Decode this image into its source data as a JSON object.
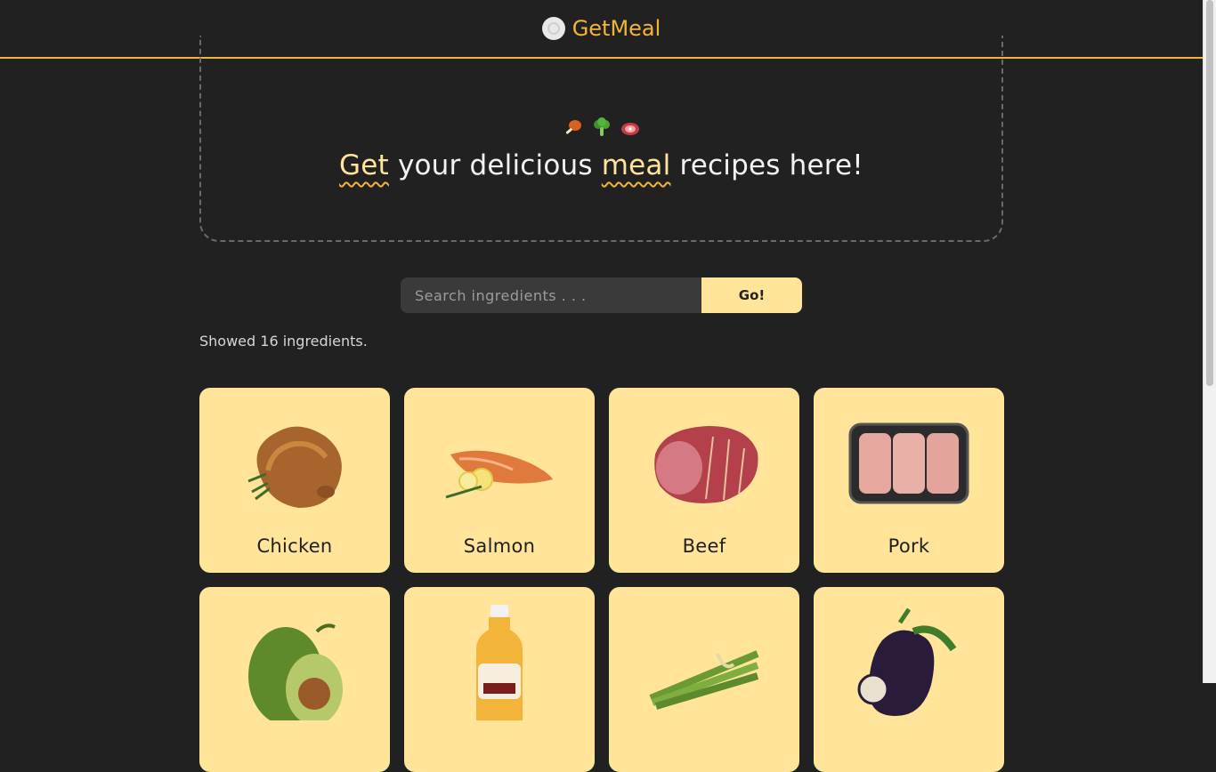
{
  "header": {
    "brand": "GetMeal"
  },
  "hero": {
    "title_parts": [
      "Get",
      " your delicious ",
      "meal",
      " recipes here!"
    ]
  },
  "search": {
    "placeholder": "Search ingredients . . .",
    "button_label": "Go!"
  },
  "results": {
    "count_text": "Showed 16 ingredients."
  },
  "ingredients": [
    {
      "name": "Chicken"
    },
    {
      "name": "Salmon"
    },
    {
      "name": "Beef"
    },
    {
      "name": "Pork"
    },
    {
      "name": ""
    },
    {
      "name": ""
    },
    {
      "name": ""
    },
    {
      "name": ""
    }
  ],
  "colors": {
    "accent": "#f2b53a",
    "card": "#ffe49a",
    "background": "#212121"
  }
}
